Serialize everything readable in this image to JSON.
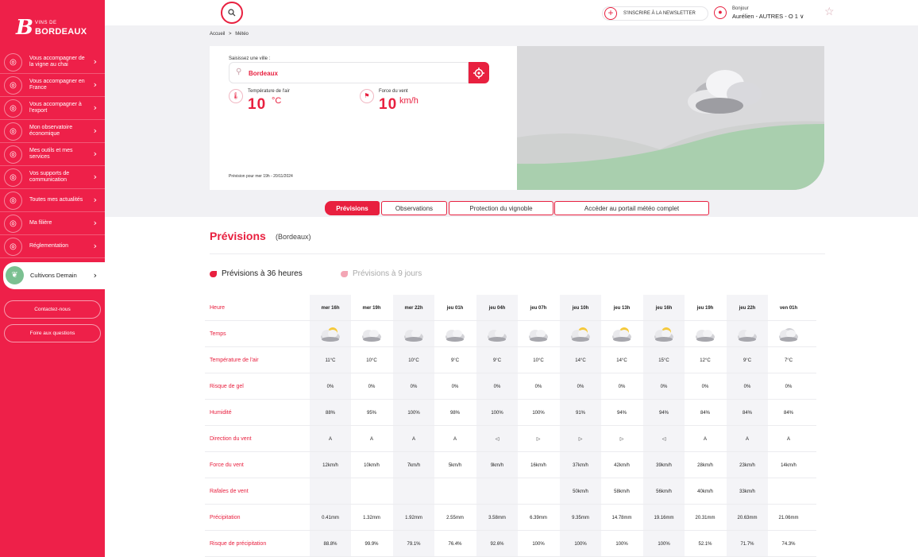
{
  "brand": {
    "small": "VINS DE",
    "big": "BORDEAUX",
    "mark": "B"
  },
  "sidebar": {
    "items": [
      {
        "label": "Vous accompagner de la vigne au chai",
        "icon": "barrel-icon"
      },
      {
        "label": "Vous accompagner en France",
        "icon": "hexagon-icon"
      },
      {
        "label": "Vous accompagner à l'export",
        "icon": "globe-icon"
      },
      {
        "label": "Mon observatoire économique",
        "icon": "chart-icon"
      },
      {
        "label": "Mes outils et mes services",
        "icon": "briefcase-icon"
      },
      {
        "label": "Vos supports de communication",
        "icon": "megaphone-icon"
      },
      {
        "label": "Toutes mes actualités",
        "icon": "news-icon"
      },
      {
        "label": "Ma filière",
        "icon": "grapes-icon"
      },
      {
        "label": "Réglementation",
        "icon": "scale-icon"
      }
    ],
    "active_item": {
      "label": "Cultivons Demain",
      "icon": "leaf-icon"
    },
    "contact": "Contactez-nous",
    "faq": "Foire aux questions"
  },
  "topbar": {
    "newsletter": "S'INSCRIRE À LA NEWSLETTER",
    "hello": "Bonjour",
    "user_name": "Aurélien - AUTRES - O 1"
  },
  "breadcrumb": {
    "home": "Accueil",
    "sep": ">",
    "current": "Météo"
  },
  "hero": {
    "city_label": "Saisissez une ville :",
    "city_value": "Bordeaux",
    "temp_label": "Température de l'air",
    "temp_value": "10",
    "temp_unit": "°C",
    "wind_label": "Force du vent",
    "wind_value": "10",
    "wind_unit": "km/h",
    "forecast_date": "Prévision pour mer 19h - 20/11/2024"
  },
  "tabs": [
    "Prévisions",
    "Observations",
    "Protection du vignoble",
    "Accéder au portail météo complet"
  ],
  "section": {
    "title": "Prévisions",
    "subtitle": "(Bordeaux)"
  },
  "subtabs": [
    "Prévisions à 36 heures",
    "Prévisions à 9 jours"
  ],
  "colors": {
    "accent": "#e8203f",
    "sidebar": "#ee2049",
    "green": "#a9cfae"
  },
  "table": {
    "row_labels": [
      "Heure",
      "Temps",
      "Température de l'air",
      "Risque de gel",
      "Humidité",
      "Direction du vent",
      "Force du vent",
      "Rafales de vent",
      "Précipitation",
      "Risque de précipitation"
    ],
    "hours": [
      "mer 16h",
      "mer 19h",
      "mer 22h",
      "jeu 01h",
      "jeu 04h",
      "jeu 07h",
      "jeu 10h",
      "jeu 13h",
      "jeu 16h",
      "jeu 19h",
      "jeu 22h",
      "ven 01h"
    ],
    "weather": [
      "sun-cloud",
      "cloud",
      "cloud",
      "cloud",
      "cloud",
      "cloud",
      "sun-cloud",
      "sun-cloud",
      "sun-cloud",
      "cloud",
      "cloud",
      "night-cloud"
    ],
    "temperature": [
      "11°C",
      "10°C",
      "10°C",
      "9°C",
      "9°C",
      "10°C",
      "14°C",
      "14°C",
      "15°C",
      "12°C",
      "9°C",
      "7°C"
    ],
    "frost": [
      "0%",
      "0%",
      "0%",
      "0%",
      "0%",
      "0%",
      "0%",
      "0%",
      "0%",
      "0%",
      "0%",
      "0%"
    ],
    "humidity": [
      "88%",
      "95%",
      "100%",
      "98%",
      "100%",
      "100%",
      "91%",
      "94%",
      "94%",
      "84%",
      "84%",
      "84%"
    ],
    "wind_dir": [
      "A",
      "A",
      "A",
      "A",
      "◁",
      "▷",
      "▷",
      "▷",
      "◁",
      "A",
      "A",
      "A"
    ],
    "wind_force": [
      "12km/h",
      "10km/h",
      "7km/h",
      "5km/h",
      "9km/h",
      "16km/h",
      "37km/h",
      "42km/h",
      "39km/h",
      "28km/h",
      "23km/h",
      "14km/h"
    ],
    "gusts": [
      "",
      "",
      "",
      "",
      "",
      "",
      "50km/h",
      "58km/h",
      "56km/h",
      "40km/h",
      "33km/h",
      ""
    ],
    "precip": [
      "0.41mm",
      "1.32mm",
      "1.92mm",
      "2.55mm",
      "3.58mm",
      "6.39mm",
      "9.35mm",
      "14.78mm",
      "19.16mm",
      "20.31mm",
      "20.63mm",
      "21.06mm"
    ],
    "precip_risk": [
      "88.8%",
      "99.9%",
      "79.1%",
      "76.4%",
      "92.6%",
      "100%",
      "100%",
      "100%",
      "100%",
      "52.1%",
      "71.7%",
      "74.3%"
    ]
  }
}
